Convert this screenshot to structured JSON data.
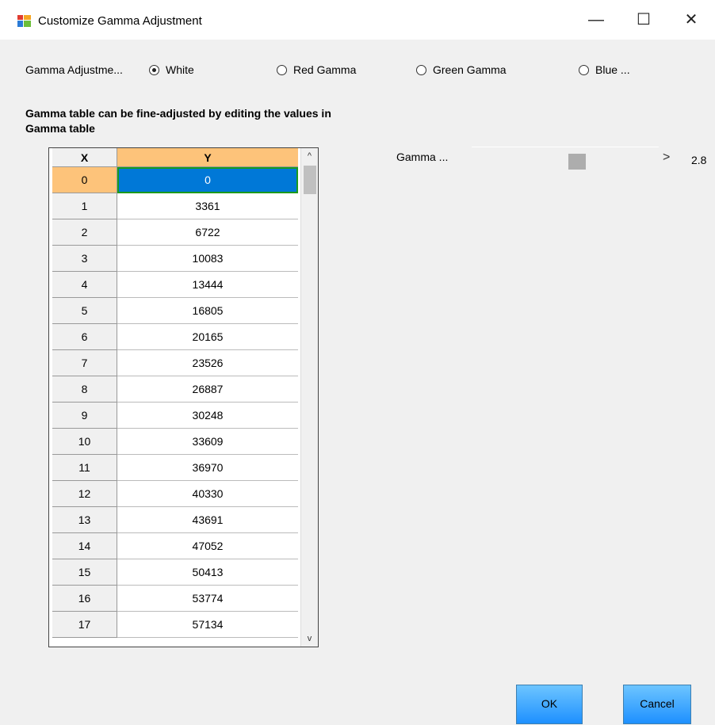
{
  "window": {
    "title": "Customize Gamma Adjustment",
    "controls": {
      "minimize": "—",
      "maximize": "☐",
      "close": "✕"
    }
  },
  "mode": {
    "label": "Gamma Adjustme...",
    "options": [
      {
        "label": "White",
        "checked": true
      },
      {
        "label": "Red Gamma",
        "checked": false
      },
      {
        "label": "Green Gamma",
        "checked": false
      },
      {
        "label": "Blue ...",
        "checked": false
      }
    ]
  },
  "hint": "Gamma table can be fine-adjusted by editing the values in Gamma table",
  "table": {
    "columns": [
      "X",
      "Y"
    ],
    "selected_row": 0,
    "rows": [
      {
        "x": "0",
        "y": "0"
      },
      {
        "x": "1",
        "y": "3361"
      },
      {
        "x": "2",
        "y": "6722"
      },
      {
        "x": "3",
        "y": "10083"
      },
      {
        "x": "4",
        "y": "13444"
      },
      {
        "x": "5",
        "y": "16805"
      },
      {
        "x": "6",
        "y": "20165"
      },
      {
        "x": "7",
        "y": "23526"
      },
      {
        "x": "8",
        "y": "26887"
      },
      {
        "x": "9",
        "y": "30248"
      },
      {
        "x": "10",
        "y": "33609"
      },
      {
        "x": "11",
        "y": "36970"
      },
      {
        "x": "12",
        "y": "40330"
      },
      {
        "x": "13",
        "y": "43691"
      },
      {
        "x": "14",
        "y": "47052"
      },
      {
        "x": "15",
        "y": "50413"
      },
      {
        "x": "16",
        "y": "53774"
      },
      {
        "x": "17",
        "y": "57134"
      }
    ]
  },
  "gamma_slider": {
    "label": "Gamma ...",
    "value": "2.8",
    "position_fraction": 0.57
  },
  "buttons": {
    "ok": "OK",
    "cancel": "Cancel"
  },
  "icons": {
    "scroll_up": "^",
    "scroll_down": "v",
    "slider_arrow": ">"
  }
}
